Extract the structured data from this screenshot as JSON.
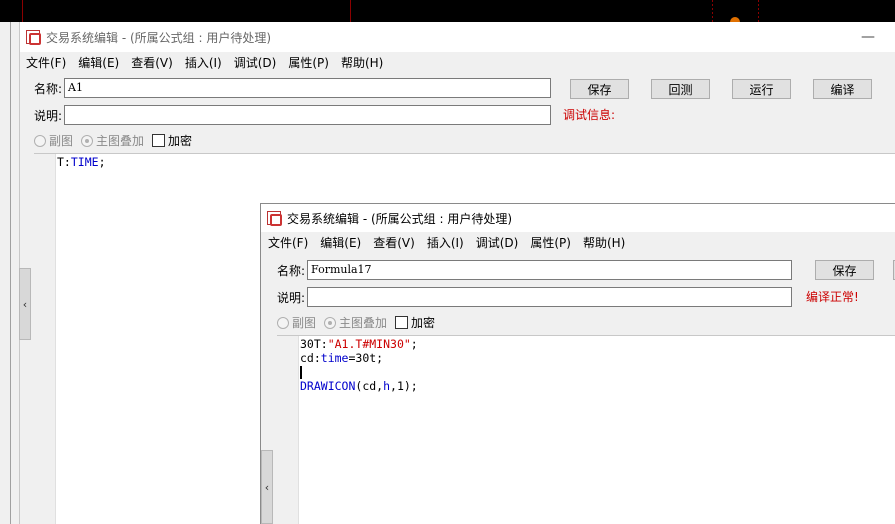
{
  "window1": {
    "title": "交易系统编辑 - (所属公式组 : 用户待处理)",
    "minimize": "—",
    "menu": [
      "文件(F)",
      "编辑(E)",
      "查看(V)",
      "插入(I)",
      "调试(D)",
      "属性(P)",
      "帮助(H)"
    ],
    "name_label": "名称:",
    "name_value": "A1",
    "desc_label": "说明:",
    "desc_value": "",
    "buttons": {
      "save": "保存",
      "backtest": "回测",
      "run": "运行",
      "compile": "编译"
    },
    "debug_info": "调试信息:",
    "options": {
      "sub_chart": "副图",
      "main_overlay": "主图叠加",
      "encrypt": "加密"
    },
    "code": {
      "l1_var": "T:",
      "l1_kw": "TIME",
      "l1_end": ";"
    }
  },
  "window2": {
    "title": "交易系统编辑 - (所属公式组 : 用户待处理)",
    "menu": [
      "文件(F)",
      "编辑(E)",
      "查看(V)",
      "插入(I)",
      "调试(D)",
      "属性(P)",
      "帮助(H)"
    ],
    "name_label": "名称:",
    "name_value": "Formula17",
    "desc_label": "说明:",
    "desc_value": "",
    "buttons": {
      "save": "保存"
    },
    "compile_status": "编译正常!",
    "options": {
      "sub_chart": "副图",
      "main_overlay": "主图叠加",
      "encrypt": "加密"
    },
    "code": {
      "l1_var": "30T:",
      "l1_str": "\"A1.T#MIN30\"",
      "l1_end": ";",
      "l2_var": "cd:",
      "l2_kw": "time",
      "l2_end": "=30t;",
      "l4_kw": "DRAWICON",
      "l4_a": "(cd,",
      "l4_kw2": "h",
      "l4_b": ",1);"
    }
  },
  "panel_toggle_icon": "‹",
  "colors": {
    "keyword": "#0000cc",
    "string": "#cc0000",
    "debug_text": "#cc0000"
  }
}
